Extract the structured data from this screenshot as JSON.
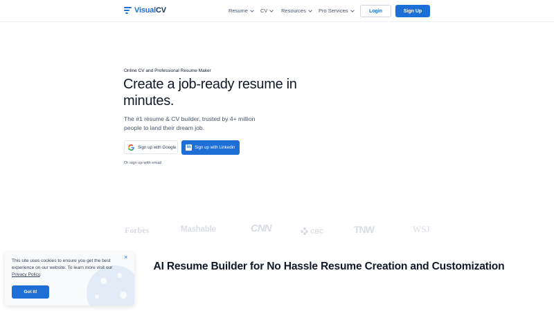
{
  "header": {
    "logo_visual": "Visual",
    "logo_cv": "CV",
    "nav": [
      {
        "label": "Resume"
      },
      {
        "label": "CV"
      },
      {
        "label": "Resources"
      },
      {
        "label": "Pro Services"
      }
    ],
    "login_label": "Login",
    "signup_label": "Sign Up"
  },
  "hero": {
    "eyebrow": "Online CV and Professional Resume Maker",
    "title": "Create a job-ready resume in minutes.",
    "subtitle": "The #1 resume & CV builder, trusted by 4+ million people to land their dream job.",
    "google_label": "Sign up with Google",
    "linkedin_label": "Sign up with Linkedin",
    "email_label": "Or sign up with email"
  },
  "press": {
    "forbes": "Forbes",
    "mashable": "Mashable",
    "cnn": "CNN",
    "cbc": "CBC",
    "tnw": "TNW",
    "wsj": "WSJ"
  },
  "section": {
    "title": "AI Resume Builder for No Hassle Resume Creation and Customization"
  },
  "cookie": {
    "text_before": "This site uses cookies to ensure you get the best experience on our website. To learn more visit our ",
    "link": "Privacy Policy",
    "text_after": ".",
    "button": "Got it!",
    "close": "×"
  },
  "colors": {
    "brand": "#1d6fd6",
    "text": "#101828",
    "muted": "#475467"
  }
}
